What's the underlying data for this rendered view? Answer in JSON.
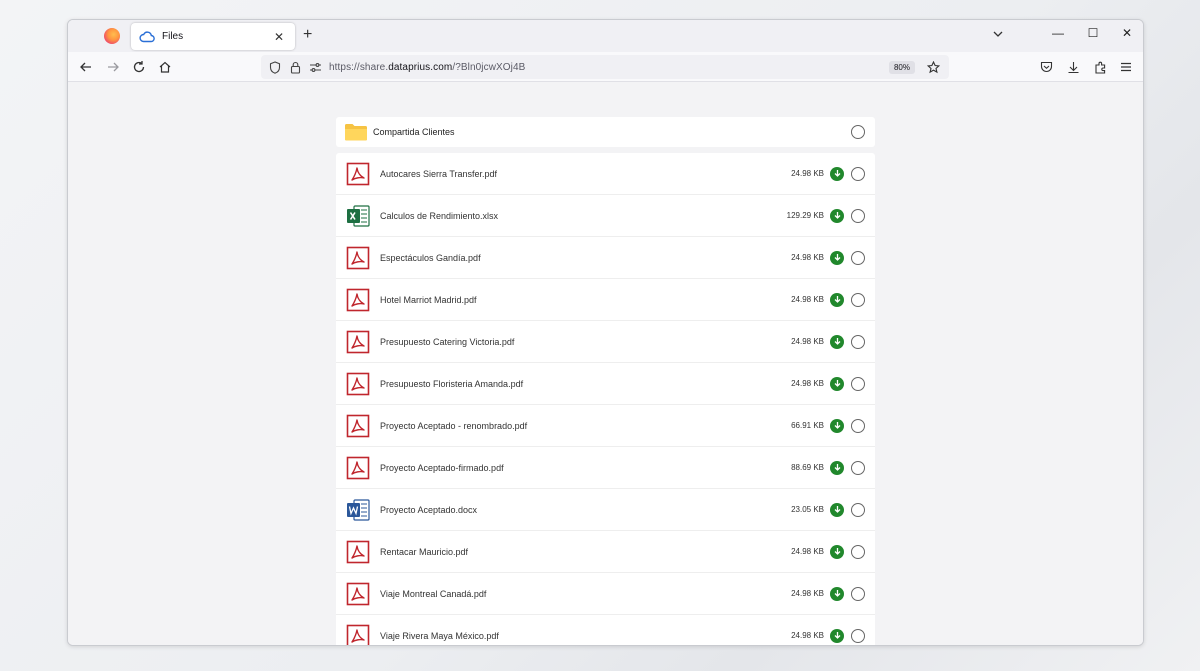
{
  "tab": {
    "title": "Files"
  },
  "address_bar": {
    "url_prefix": "https://share.",
    "url_host": "dataprius.com",
    "url_suffix": "/?Bln0jcwXOj4B",
    "zoom": "80%"
  },
  "folder": {
    "name": "Compartida Clientes"
  },
  "files": [
    {
      "name": "Autocares Sierra Transfer.pdf",
      "size": "24.98 KB",
      "type": "pdf"
    },
    {
      "name": "Calculos de Rendimiento.xlsx",
      "size": "129.29 KB",
      "type": "xlsx"
    },
    {
      "name": "Espectáculos Gandía.pdf",
      "size": "24.98 KB",
      "type": "pdf"
    },
    {
      "name": "Hotel Marriot Madrid.pdf",
      "size": "24.98 KB",
      "type": "pdf"
    },
    {
      "name": "Presupuesto Catering Victoria.pdf",
      "size": "24.98 KB",
      "type": "pdf"
    },
    {
      "name": "Presupuesto Floristeria Amanda.pdf",
      "size": "24.98 KB",
      "type": "pdf"
    },
    {
      "name": "Proyecto Aceptado - renombrado.pdf",
      "size": "66.91 KB",
      "type": "pdf"
    },
    {
      "name": "Proyecto Aceptado-firmado.pdf",
      "size": "88.69 KB",
      "type": "pdf"
    },
    {
      "name": "Proyecto Aceptado.docx",
      "size": "23.05 KB",
      "type": "docx"
    },
    {
      "name": "Rentacar Mauricio.pdf",
      "size": "24.98 KB",
      "type": "pdf"
    },
    {
      "name": "Viaje Montreal Canadá.pdf",
      "size": "24.98 KB",
      "type": "pdf"
    },
    {
      "name": "Viaje Rivera Maya México.pdf",
      "size": "24.98 KB",
      "type": "pdf"
    }
  ],
  "colors": {
    "download_green": "#21882c",
    "pdf_red": "#c0262d",
    "excel_green": "#1d6f42",
    "word_blue": "#2b579a",
    "folder_yellow": "#f6c343"
  }
}
